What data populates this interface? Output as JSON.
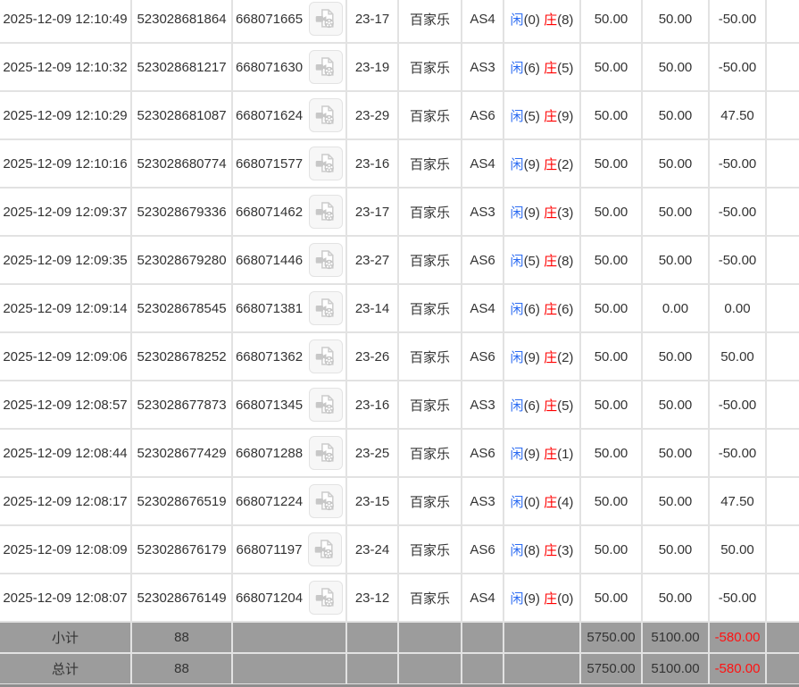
{
  "colors": {
    "link_blue": "#2c6cf2",
    "banker_red": "#ff0000",
    "loss_red": "#ff0000",
    "text_dark": "#333333",
    "footer_gray": "#9c9c9c",
    "border_gray": "#e2e2e2"
  },
  "icons": {
    "video_button": "video-file-icon"
  },
  "table": {
    "rows": [
      {
        "time": "2025-12-09 12:10:49",
        "bet_id": "523028681864",
        "round_id": "668071665",
        "round_code": "23-17",
        "game": "百家乐",
        "table_code": "AS4",
        "player": "闲",
        "player_pts": "(0)",
        "banker": "庄",
        "banker_pts": "(8)",
        "bet": "50.00",
        "valid": "50.00",
        "payout": "-50.00"
      },
      {
        "time": "2025-12-09 12:10:32",
        "bet_id": "523028681217",
        "round_id": "668071630",
        "round_code": "23-19",
        "game": "百家乐",
        "table_code": "AS3",
        "player": "闲",
        "player_pts": "(6)",
        "banker": "庄",
        "banker_pts": "(5)",
        "bet": "50.00",
        "valid": "50.00",
        "payout": "-50.00"
      },
      {
        "time": "2025-12-09 12:10:29",
        "bet_id": "523028681087",
        "round_id": "668071624",
        "round_code": "23-29",
        "game": "百家乐",
        "table_code": "AS6",
        "player": "闲",
        "player_pts": "(5)",
        "banker": "庄",
        "banker_pts": "(9)",
        "bet": "50.00",
        "valid": "50.00",
        "payout": "47.50"
      },
      {
        "time": "2025-12-09 12:10:16",
        "bet_id": "523028680774",
        "round_id": "668071577",
        "round_code": "23-16",
        "game": "百家乐",
        "table_code": "AS4",
        "player": "闲",
        "player_pts": "(9)",
        "banker": "庄",
        "banker_pts": "(2)",
        "bet": "50.00",
        "valid": "50.00",
        "payout": "-50.00"
      },
      {
        "time": "2025-12-09 12:09:37",
        "bet_id": "523028679336",
        "round_id": "668071462",
        "round_code": "23-17",
        "game": "百家乐",
        "table_code": "AS3",
        "player": "闲",
        "player_pts": "(9)",
        "banker": "庄",
        "banker_pts": "(3)",
        "bet": "50.00",
        "valid": "50.00",
        "payout": "-50.00"
      },
      {
        "time": "2025-12-09 12:09:35",
        "bet_id": "523028679280",
        "round_id": "668071446",
        "round_code": "23-27",
        "game": "百家乐",
        "table_code": "AS6",
        "player": "闲",
        "player_pts": "(5)",
        "banker": "庄",
        "banker_pts": "(8)",
        "bet": "50.00",
        "valid": "50.00",
        "payout": "-50.00"
      },
      {
        "time": "2025-12-09 12:09:14",
        "bet_id": "523028678545",
        "round_id": "668071381",
        "round_code": "23-14",
        "game": "百家乐",
        "table_code": "AS4",
        "player": "闲",
        "player_pts": "(6)",
        "banker": "庄",
        "banker_pts": "(6)",
        "bet": "50.00",
        "valid": "0.00",
        "payout": "0.00"
      },
      {
        "time": "2025-12-09 12:09:06",
        "bet_id": "523028678252",
        "round_id": "668071362",
        "round_code": "23-26",
        "game": "百家乐",
        "table_code": "AS6",
        "player": "闲",
        "player_pts": "(9)",
        "banker": "庄",
        "banker_pts": "(2)",
        "bet": "50.00",
        "valid": "50.00",
        "payout": "50.00"
      },
      {
        "time": "2025-12-09 12:08:57",
        "bet_id": "523028677873",
        "round_id": "668071345",
        "round_code": "23-16",
        "game": "百家乐",
        "table_code": "AS3",
        "player": "闲",
        "player_pts": "(6)",
        "banker": "庄",
        "banker_pts": "(5)",
        "bet": "50.00",
        "valid": "50.00",
        "payout": "-50.00"
      },
      {
        "time": "2025-12-09 12:08:44",
        "bet_id": "523028677429",
        "round_id": "668071288",
        "round_code": "23-25",
        "game": "百家乐",
        "table_code": "AS6",
        "player": "闲",
        "player_pts": "(9)",
        "banker": "庄",
        "banker_pts": "(1)",
        "bet": "50.00",
        "valid": "50.00",
        "payout": "-50.00"
      },
      {
        "time": "2025-12-09 12:08:17",
        "bet_id": "523028676519",
        "round_id": "668071224",
        "round_code": "23-15",
        "game": "百家乐",
        "table_code": "AS3",
        "player": "闲",
        "player_pts": "(0)",
        "banker": "庄",
        "banker_pts": "(4)",
        "bet": "50.00",
        "valid": "50.00",
        "payout": "47.50"
      },
      {
        "time": "2025-12-09 12:08:09",
        "bet_id": "523028676179",
        "round_id": "668071197",
        "round_code": "23-24",
        "game": "百家乐",
        "table_code": "AS6",
        "player": "闲",
        "player_pts": "(8)",
        "banker": "庄",
        "banker_pts": "(3)",
        "bet": "50.00",
        "valid": "50.00",
        "payout": "50.00"
      },
      {
        "time": "2025-12-09 12:08:07",
        "bet_id": "523028676149",
        "round_id": "668071204",
        "round_code": "23-12",
        "game": "百家乐",
        "table_code": "AS4",
        "player": "闲",
        "player_pts": "(9)",
        "banker": "庄",
        "banker_pts": "(0)",
        "bet": "50.00",
        "valid": "50.00",
        "payout": "-50.00"
      }
    ],
    "footer": {
      "subtotal": {
        "label": "小计",
        "count": "88",
        "bet": "5750.00",
        "valid": "5100.00",
        "win_loss": "-580.00"
      },
      "total": {
        "label": "总计",
        "count": "88",
        "bet": "5750.00",
        "valid": "5100.00",
        "win_loss": "-580.00"
      }
    }
  }
}
